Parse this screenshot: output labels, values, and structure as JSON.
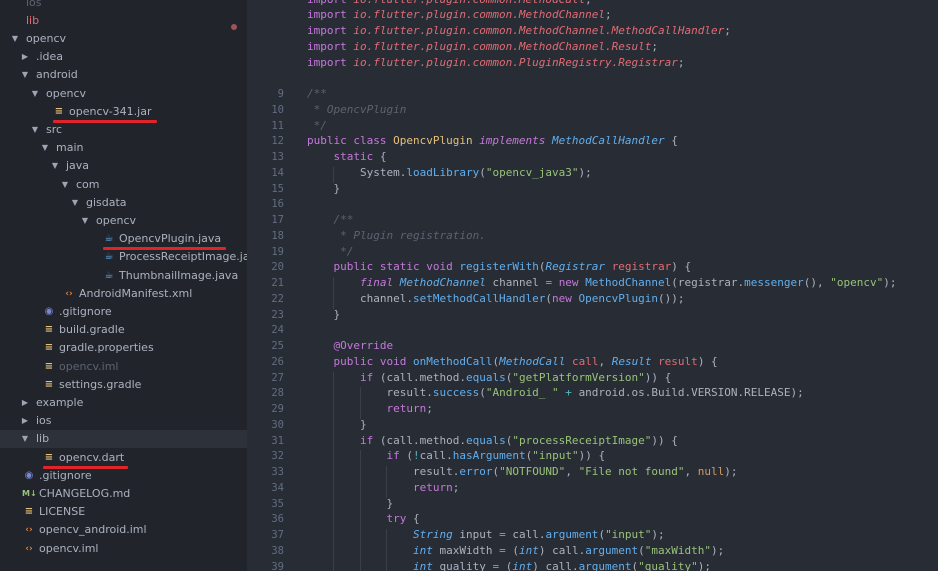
{
  "sidebar": {
    "items": [
      {
        "label": "ios",
        "depth": 0,
        "arrow": "",
        "icon": "",
        "style": "dim"
      },
      {
        "label": "lib",
        "depth": 0,
        "arrow": "",
        "icon": "",
        "style": "red",
        "modified": true
      },
      {
        "label": "opencv",
        "depth": 0,
        "arrow": "down",
        "icon": ""
      },
      {
        "label": ".idea",
        "depth": 1,
        "arrow": "right",
        "icon": ""
      },
      {
        "label": "android",
        "depth": 1,
        "arrow": "down",
        "icon": ""
      },
      {
        "label": "opencv",
        "depth": 2,
        "arrow": "down",
        "icon": ""
      },
      {
        "label": "opencv-341.jar",
        "depth": 3,
        "arrow": "",
        "icon": "jar",
        "highlight": true
      },
      {
        "label": "src",
        "depth": 2,
        "arrow": "down",
        "icon": ""
      },
      {
        "label": "main",
        "depth": 3,
        "arrow": "down",
        "icon": ""
      },
      {
        "label": "java",
        "depth": 4,
        "arrow": "down",
        "icon": ""
      },
      {
        "label": "com",
        "depth": 5,
        "arrow": "down",
        "icon": ""
      },
      {
        "label": "gisdata",
        "depth": 6,
        "arrow": "down",
        "icon": ""
      },
      {
        "label": "opencv",
        "depth": 7,
        "arrow": "down",
        "icon": ""
      },
      {
        "label": "OpencvPlugin.java",
        "depth": 8,
        "arrow": "",
        "icon": "java",
        "highlight": true
      },
      {
        "label": "ProcessReceiptImage.java",
        "depth": 8,
        "arrow": "",
        "icon": "java"
      },
      {
        "label": "ThumbnailImage.java",
        "depth": 8,
        "arrow": "",
        "icon": "java"
      },
      {
        "label": "AndroidManifest.xml",
        "depth": 4,
        "arrow": "",
        "icon": "xml"
      },
      {
        "label": ".gitignore",
        "depth": 2,
        "arrow": "",
        "icon": "git"
      },
      {
        "label": "build.gradle",
        "depth": 2,
        "arrow": "",
        "icon": "txt"
      },
      {
        "label": "gradle.properties",
        "depth": 2,
        "arrow": "",
        "icon": "txt"
      },
      {
        "label": "opencv.iml",
        "depth": 2,
        "arrow": "",
        "icon": "txt",
        "style": "dim"
      },
      {
        "label": "settings.gradle",
        "depth": 2,
        "arrow": "",
        "icon": "txt"
      },
      {
        "label": "example",
        "depth": 1,
        "arrow": "right",
        "icon": ""
      },
      {
        "label": "ios",
        "depth": 1,
        "arrow": "right",
        "icon": ""
      },
      {
        "label": "lib",
        "depth": 1,
        "arrow": "down",
        "icon": "",
        "selected": true
      },
      {
        "label": "opencv.dart",
        "depth": 2,
        "arrow": "",
        "icon": "txt",
        "highlight": true
      },
      {
        "label": ".gitignore",
        "depth": 0,
        "arrow": "",
        "icon": "git"
      },
      {
        "label": "CHANGELOG.md",
        "depth": 0,
        "arrow": "",
        "icon": "md"
      },
      {
        "label": "LICENSE",
        "depth": 0,
        "arrow": "",
        "icon": "txt"
      },
      {
        "label": "opencv_android.iml",
        "depth": 0,
        "arrow": "",
        "icon": "iml"
      },
      {
        "label": "opencv.iml",
        "depth": 0,
        "arrow": "",
        "icon": "iml"
      }
    ]
  },
  "editor": {
    "lines": [
      {
        "n": "",
        "t": [
          [
            "t-kw",
            "import "
          ],
          [
            "t-pkg",
            "io.flutter.plugin.common.MethodCall"
          ],
          [
            "t-pl",
            ";"
          ]
        ]
      },
      {
        "n": "",
        "t": [
          [
            "t-kw",
            "import "
          ],
          [
            "t-pkg",
            "io.flutter.plugin.common.MethodChannel"
          ],
          [
            "t-pl",
            ";"
          ]
        ]
      },
      {
        "n": "",
        "t": [
          [
            "t-kw",
            "import "
          ],
          [
            "t-pkg",
            "io.flutter.plugin.common.MethodChannel.MethodCallHandler"
          ],
          [
            "t-pl",
            ";"
          ]
        ]
      },
      {
        "n": "",
        "t": [
          [
            "t-kw",
            "import "
          ],
          [
            "t-pkg",
            "io.flutter.plugin.common.MethodChannel.Result"
          ],
          [
            "t-pl",
            ";"
          ]
        ]
      },
      {
        "n": "",
        "t": [
          [
            "t-kw",
            "import "
          ],
          [
            "t-pkg",
            "io.flutter.plugin.common.PluginRegistry.Registrar"
          ],
          [
            "t-pl",
            ";"
          ]
        ]
      },
      {
        "n": "",
        "t": []
      },
      {
        "n": "9",
        "t": [
          [
            "t-com",
            "/**"
          ]
        ]
      },
      {
        "n": "10",
        "t": [
          [
            "t-com",
            " * OpencvPlugin"
          ]
        ]
      },
      {
        "n": "11",
        "t": [
          [
            "t-com",
            " */"
          ]
        ]
      },
      {
        "n": "12",
        "t": [
          [
            "t-kw",
            "public class "
          ],
          [
            "t-ty",
            "OpencvPlugin "
          ],
          [
            "t-kwi",
            "implements "
          ],
          [
            "t-tyi",
            "MethodCallHandler"
          ],
          [
            "t-pl",
            " {"
          ]
        ]
      },
      {
        "n": "13",
        "t": [
          [
            "t-pl",
            "    "
          ],
          [
            "t-kw",
            "static"
          ],
          [
            "t-pl",
            " {"
          ]
        ]
      },
      {
        "n": "14",
        "t": [
          [
            "t-pl",
            "        System."
          ],
          [
            "t-fn",
            "loadLibrary"
          ],
          [
            "t-pl",
            "("
          ],
          [
            "t-str",
            "\"opencv_java3\""
          ],
          [
            "t-pl",
            ");"
          ]
        ]
      },
      {
        "n": "15",
        "t": [
          [
            "t-pl",
            "    }"
          ]
        ]
      },
      {
        "n": "16",
        "t": []
      },
      {
        "n": "17",
        "t": [
          [
            "t-com",
            "    /**"
          ]
        ]
      },
      {
        "n": "18",
        "t": [
          [
            "t-com",
            "     * Plugin registration."
          ]
        ]
      },
      {
        "n": "19",
        "t": [
          [
            "t-com",
            "     */"
          ]
        ]
      },
      {
        "n": "20",
        "t": [
          [
            "t-pl",
            "    "
          ],
          [
            "t-kw",
            "public static void "
          ],
          [
            "t-fn",
            "registerWith"
          ],
          [
            "t-pl",
            "("
          ],
          [
            "t-tyi",
            "Registrar "
          ],
          [
            "t-var",
            "registrar"
          ],
          [
            "t-pl",
            ") {"
          ]
        ]
      },
      {
        "n": "21",
        "t": [
          [
            "t-pl",
            "        "
          ],
          [
            "t-kwi",
            "final "
          ],
          [
            "t-tyi",
            "MethodChannel "
          ],
          [
            "t-pl",
            "channel "
          ],
          [
            "t-op",
            "= "
          ],
          [
            "t-kw",
            "new "
          ],
          [
            "t-fn",
            "MethodChannel"
          ],
          [
            "t-pl",
            "(registrar."
          ],
          [
            "t-fn",
            "messenger"
          ],
          [
            "t-pl",
            "(), "
          ],
          [
            "t-str",
            "\"opencv\""
          ],
          [
            "t-pl",
            ");"
          ]
        ]
      },
      {
        "n": "22",
        "t": [
          [
            "t-pl",
            "        channel."
          ],
          [
            "t-fn",
            "setMethodCallHandler"
          ],
          [
            "t-pl",
            "("
          ],
          [
            "t-kw",
            "new "
          ],
          [
            "t-fn",
            "OpencvPlugin"
          ],
          [
            "t-pl",
            "());"
          ]
        ]
      },
      {
        "n": "23",
        "t": [
          [
            "t-pl",
            "    }"
          ]
        ]
      },
      {
        "n": "24",
        "t": []
      },
      {
        "n": "25",
        "t": [
          [
            "t-pl",
            "    "
          ],
          [
            "t-ann",
            "@Override"
          ]
        ]
      },
      {
        "n": "26",
        "t": [
          [
            "t-pl",
            "    "
          ],
          [
            "t-kw",
            "public void "
          ],
          [
            "t-fn",
            "onMethodCall"
          ],
          [
            "t-pl",
            "("
          ],
          [
            "t-tyi",
            "MethodCall "
          ],
          [
            "t-var",
            "call"
          ],
          [
            "t-pl",
            ", "
          ],
          [
            "t-tyi",
            "Result "
          ],
          [
            "t-var",
            "result"
          ],
          [
            "t-pl",
            ") {"
          ]
        ]
      },
      {
        "n": "27",
        "t": [
          [
            "t-pl",
            "        "
          ],
          [
            "t-kw",
            "if "
          ],
          [
            "t-pl",
            "(call.method."
          ],
          [
            "t-fn",
            "equals"
          ],
          [
            "t-pl",
            "("
          ],
          [
            "t-str",
            "\"getPlatformVersion\""
          ],
          [
            "t-pl",
            ")) {"
          ]
        ]
      },
      {
        "n": "28",
        "t": [
          [
            "t-pl",
            "            result."
          ],
          [
            "t-fn",
            "success"
          ],
          [
            "t-pl",
            "("
          ],
          [
            "t-str",
            "\"Android_ \""
          ],
          [
            "t-op",
            " + "
          ],
          [
            "t-pl",
            "android.os.Build.VERSION.RELEASE);"
          ]
        ]
      },
      {
        "n": "29",
        "t": [
          [
            "t-pl",
            "            "
          ],
          [
            "t-kw",
            "return"
          ],
          [
            "t-pl",
            ";"
          ]
        ]
      },
      {
        "n": "30",
        "t": [
          [
            "t-pl",
            "        }"
          ]
        ]
      },
      {
        "n": "31",
        "t": [
          [
            "t-pl",
            "        "
          ],
          [
            "t-kw",
            "if "
          ],
          [
            "t-pl",
            "(call.method."
          ],
          [
            "t-fn",
            "equals"
          ],
          [
            "t-pl",
            "("
          ],
          [
            "t-str",
            "\"processReceiptImage\""
          ],
          [
            "t-pl",
            ")) {"
          ]
        ]
      },
      {
        "n": "32",
        "t": [
          [
            "t-pl",
            "            "
          ],
          [
            "t-kw",
            "if "
          ],
          [
            "t-pl",
            "("
          ],
          [
            "t-op",
            "!"
          ],
          [
            "t-pl",
            "call."
          ],
          [
            "t-fn",
            "hasArgument"
          ],
          [
            "t-pl",
            "("
          ],
          [
            "t-str",
            "\"input\""
          ],
          [
            "t-pl",
            ")) {"
          ]
        ]
      },
      {
        "n": "33",
        "t": [
          [
            "t-pl",
            "                result."
          ],
          [
            "t-fn",
            "error"
          ],
          [
            "t-pl",
            "("
          ],
          [
            "t-str",
            "\"NOTFOUND\""
          ],
          [
            "t-pl",
            ", "
          ],
          [
            "t-str",
            "\"File not found\""
          ],
          [
            "t-pl",
            ", "
          ],
          [
            "t-num",
            "null"
          ],
          [
            "t-pl",
            ");"
          ]
        ]
      },
      {
        "n": "34",
        "t": [
          [
            "t-pl",
            "                "
          ],
          [
            "t-kw",
            "return"
          ],
          [
            "t-pl",
            ";"
          ]
        ]
      },
      {
        "n": "35",
        "t": [
          [
            "t-pl",
            "            }"
          ]
        ]
      },
      {
        "n": "36",
        "t": [
          [
            "t-pl",
            "            "
          ],
          [
            "t-kw",
            "try "
          ],
          [
            "t-pl",
            "{"
          ]
        ]
      },
      {
        "n": "37",
        "t": [
          [
            "t-pl",
            "                "
          ],
          [
            "t-tyi",
            "String "
          ],
          [
            "t-pl",
            "input "
          ],
          [
            "t-op",
            "= "
          ],
          [
            "t-pl",
            "call."
          ],
          [
            "t-fn",
            "argument"
          ],
          [
            "t-pl",
            "("
          ],
          [
            "t-str",
            "\"input\""
          ],
          [
            "t-pl",
            ");"
          ]
        ]
      },
      {
        "n": "38",
        "t": [
          [
            "t-pl",
            "                "
          ],
          [
            "t-tyi",
            "int "
          ],
          [
            "t-pl",
            "maxWidth "
          ],
          [
            "t-op",
            "= "
          ],
          [
            "t-pl",
            "("
          ],
          [
            "t-tyi",
            "int"
          ],
          [
            "t-pl",
            ") call."
          ],
          [
            "t-fn",
            "argument"
          ],
          [
            "t-pl",
            "("
          ],
          [
            "t-str",
            "\"maxWidth\""
          ],
          [
            "t-pl",
            ");"
          ]
        ]
      },
      {
        "n": "39",
        "t": [
          [
            "t-pl",
            "                "
          ],
          [
            "t-tyi",
            "int "
          ],
          [
            "t-pl",
            "quality "
          ],
          [
            "t-op",
            "= "
          ],
          [
            "t-pl",
            "("
          ],
          [
            "t-tyi",
            "int"
          ],
          [
            "t-pl",
            ") call."
          ],
          [
            "t-fn",
            "argument"
          ],
          [
            "t-pl",
            "("
          ],
          [
            "t-str",
            "\"quality\""
          ],
          [
            "t-pl",
            ");"
          ]
        ]
      }
    ]
  }
}
